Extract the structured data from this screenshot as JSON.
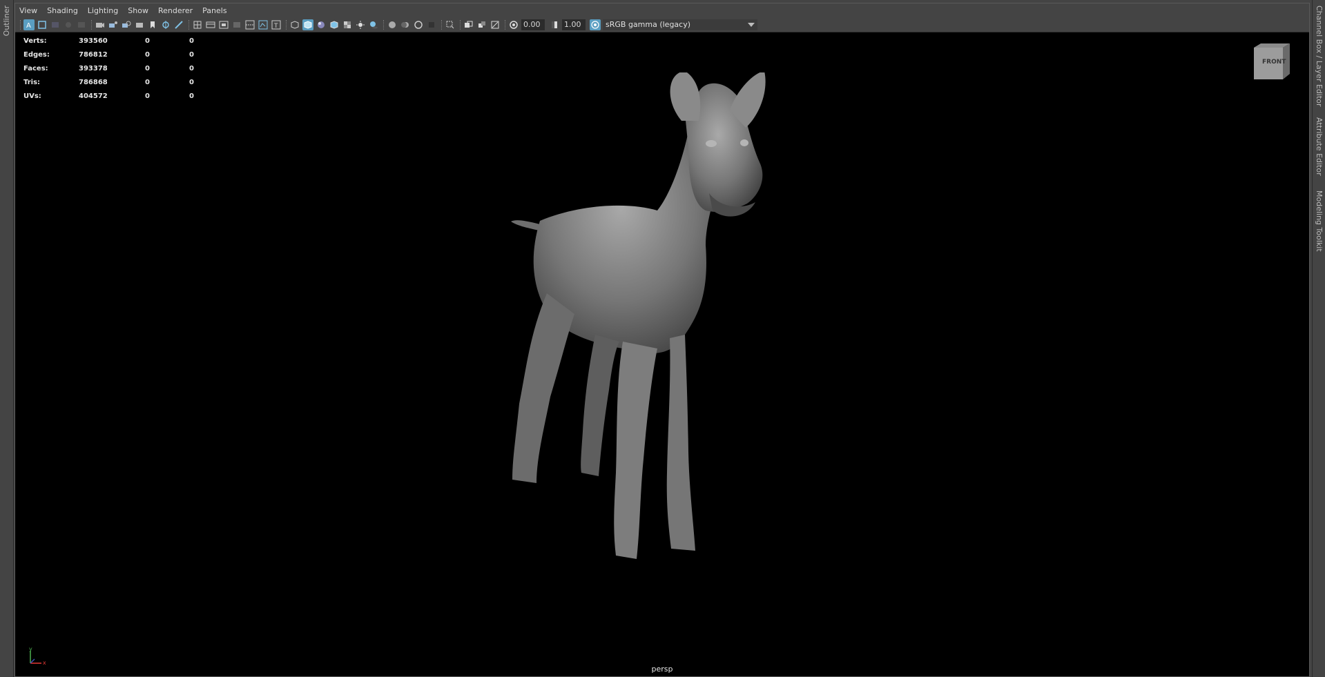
{
  "side_tabs": {
    "left": [
      "Outliner"
    ],
    "right": [
      "Channel Box / Layer Editor",
      "Attribute Editor",
      "Modeling Toolkit"
    ]
  },
  "menubar": {
    "items": [
      "View",
      "Shading",
      "Lighting",
      "Show",
      "Renderer",
      "Panels"
    ]
  },
  "toolbar": {
    "exposure_value": "0.00",
    "gamma_value": "1.00",
    "color_space": "sRGB gamma (legacy)",
    "accent_color": "#5a9ec2"
  },
  "hud": {
    "rows": [
      {
        "label": "Verts:",
        "total": "393560",
        "selected": "0",
        "components": "0"
      },
      {
        "label": "Edges:",
        "total": "786812",
        "selected": "0",
        "components": "0"
      },
      {
        "label": "Faces:",
        "total": "393378",
        "selected": "0",
        "components": "0"
      },
      {
        "label": "Tris:",
        "total": "786868",
        "selected": "0",
        "components": "0"
      },
      {
        "label": "UVs:",
        "total": "404572",
        "selected": "0",
        "components": "0"
      }
    ]
  },
  "viewcube": {
    "face": "FRONT"
  },
  "camera": {
    "name": "persp"
  },
  "axis": {
    "y": "y",
    "x": "x"
  }
}
